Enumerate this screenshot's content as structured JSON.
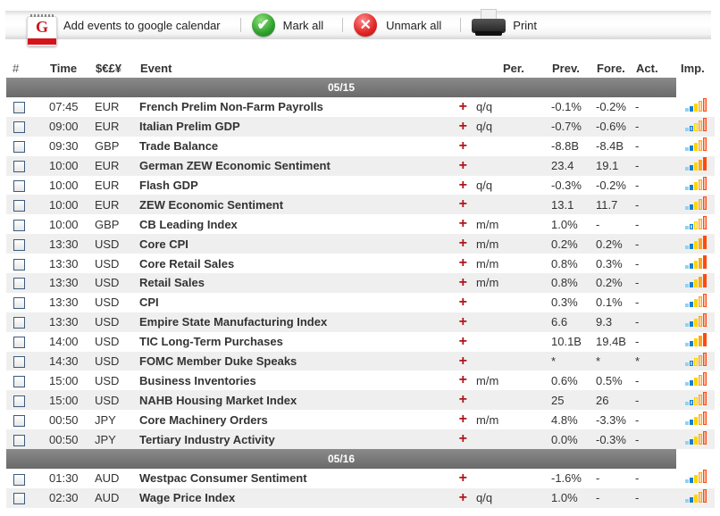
{
  "toolbar": {
    "google_calendar_label": "Add events to google calendar",
    "mark_all_label": "Mark all",
    "unmark_all_label": "Unmark all",
    "print_label": "Print"
  },
  "table": {
    "headers": [
      "#",
      "Time",
      "$€£¥",
      "Event",
      "Per.",
      "Prev.",
      "Fore.",
      "Act.",
      "Imp."
    ],
    "sections": [
      {
        "date": "05/15",
        "rows": [
          {
            "time": "07:45",
            "currency": "EUR",
            "event": "French Prelim Non-Farm Payrolls",
            "period": "q/q",
            "prev": "-0.1%",
            "fore": "-0.2%",
            "act": "-",
            "importance": 3
          },
          {
            "time": "09:00",
            "currency": "EUR",
            "event": "Italian Prelim GDP",
            "period": "q/q",
            "prev": "-0.7%",
            "fore": "-0.6%",
            "act": "-",
            "importance": 1
          },
          {
            "time": "09:30",
            "currency": "GBP",
            "event": "Trade Balance",
            "period": "",
            "prev": "-8.8B",
            "fore": "-8.4B",
            "act": "-",
            "importance": 3
          },
          {
            "time": "10:00",
            "currency": "EUR",
            "event": "German ZEW Economic Sentiment",
            "period": "",
            "prev": "23.4",
            "fore": "19.1",
            "act": "-",
            "importance": 5
          },
          {
            "time": "10:00",
            "currency": "EUR",
            "event": "Flash GDP",
            "period": "q/q",
            "prev": "-0.3%",
            "fore": "-0.2%",
            "act": "-",
            "importance": 3
          },
          {
            "time": "10:00",
            "currency": "EUR",
            "event": "ZEW Economic Sentiment",
            "period": "",
            "prev": "13.1",
            "fore": "11.7",
            "act": "-",
            "importance": 3
          },
          {
            "time": "10:00",
            "currency": "GBP",
            "event": "CB Leading Index",
            "period": "m/m",
            "prev": "1.0%",
            "fore": "-",
            "act": "-",
            "importance": 1
          },
          {
            "time": "13:30",
            "currency": "USD",
            "event": "Core CPI",
            "period": "m/m",
            "prev": "0.2%",
            "fore": "0.2%",
            "act": "-",
            "importance": 5
          },
          {
            "time": "13:30",
            "currency": "USD",
            "event": "Core Retail Sales",
            "period": "m/m",
            "prev": "0.8%",
            "fore": "0.3%",
            "act": "-",
            "importance": 5
          },
          {
            "time": "13:30",
            "currency": "USD",
            "event": "Retail Sales",
            "period": "m/m",
            "prev": "0.8%",
            "fore": "0.2%",
            "act": "-",
            "importance": 5
          },
          {
            "time": "13:30",
            "currency": "USD",
            "event": "CPI",
            "period": "",
            "prev": "0.3%",
            "fore": "0.1%",
            "act": "-",
            "importance": 3
          },
          {
            "time": "13:30",
            "currency": "USD",
            "event": "Empire State Manufacturing Index",
            "period": "",
            "prev": "6.6",
            "fore": "9.3",
            "act": "-",
            "importance": 3
          },
          {
            "time": "14:00",
            "currency": "USD",
            "event": "TIC Long-Term Purchases",
            "period": "",
            "prev": "10.1B",
            "fore": "19.4B",
            "act": "-",
            "importance": 5
          },
          {
            "time": "14:30",
            "currency": "USD",
            "event": "FOMC Member Duke Speaks",
            "period": "",
            "prev": "*",
            "fore": "*",
            "act": "*",
            "importance": 1
          },
          {
            "time": "15:00",
            "currency": "USD",
            "event": "Business Inventories",
            "period": "m/m",
            "prev": "0.6%",
            "fore": "0.5%",
            "act": "-",
            "importance": 3
          },
          {
            "time": "15:00",
            "currency": "USD",
            "event": "NAHB Housing Market Index",
            "period": "",
            "prev": "25",
            "fore": "26",
            "act": "-",
            "importance": 1
          },
          {
            "time": "00:50",
            "currency": "JPY",
            "event": "Core Machinery Orders",
            "period": "m/m",
            "prev": "4.8%",
            "fore": "-3.3%",
            "act": "-",
            "importance": 3
          },
          {
            "time": "00:50",
            "currency": "JPY",
            "event": "Tertiary Industry Activity",
            "period": "",
            "prev": "0.0%",
            "fore": "-0.3%",
            "act": "-",
            "importance": 3
          }
        ]
      },
      {
        "date": "05/16",
        "rows": [
          {
            "time": "01:30",
            "currency": "AUD",
            "event": "Westpac Consumer Sentiment",
            "period": "",
            "prev": "-1.6%",
            "fore": "-",
            "act": "-",
            "importance": 3
          },
          {
            "time": "02:30",
            "currency": "AUD",
            "event": "Wage Price Index",
            "period": "q/q",
            "prev": "1.0%",
            "fore": "-",
            "act": "-",
            "importance": 3
          }
        ]
      }
    ]
  },
  "colors": {
    "importance_bars": [
      "#8fd3f4",
      "#1a7fcf",
      "#ffd500",
      "#ffa51f",
      "#ff4a10"
    ],
    "plus": "#b0141c",
    "date_bar": "#7a7a7a",
    "row_alt": "#efefef"
  },
  "icons": {
    "google_calendar": "google-calendar-icon",
    "mark_all": "check-circle-icon",
    "unmark_all": "x-circle-icon",
    "print": "printer-icon",
    "add_event": "plus-icon",
    "importance": "importance-bars-icon"
  }
}
